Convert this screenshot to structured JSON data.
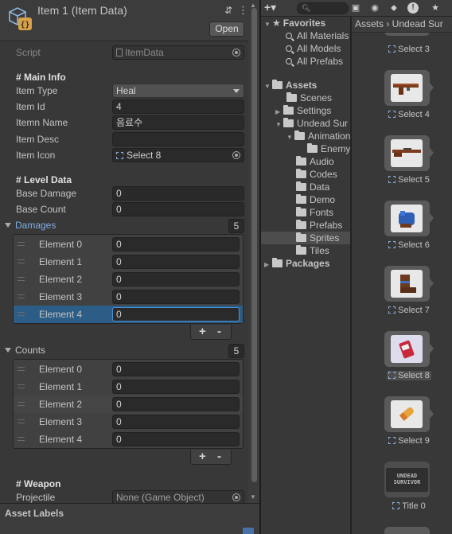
{
  "inspector": {
    "title": "Item 1 (Item Data)",
    "open_label": "Open",
    "script": {
      "label": "Script",
      "value": "ItemData"
    },
    "main_info": {
      "header": "# Main Info",
      "item_type": {
        "label": "Item Type",
        "value": "Heal"
      },
      "item_id": {
        "label": "Item Id",
        "value": "4"
      },
      "item_name": {
        "label": "Itemn Name",
        "value": "음료수"
      },
      "item_desc": {
        "label": "Item Desc",
        "value": ""
      },
      "item_icon": {
        "label": "Item Icon",
        "value": "Select 8"
      }
    },
    "level_data": {
      "header": "# Level Data",
      "base_damage": {
        "label": "Base Damage",
        "value": "0"
      },
      "base_count": {
        "label": "Base Count",
        "value": "0"
      }
    },
    "damages": {
      "label": "Damages",
      "count": "5",
      "elements": [
        {
          "label": "Element 0",
          "value": "0"
        },
        {
          "label": "Element 1",
          "value": "0"
        },
        {
          "label": "Element 2",
          "value": "0"
        },
        {
          "label": "Element 3",
          "value": "0"
        },
        {
          "label": "Element 4",
          "value": "0"
        }
      ],
      "selected_index": 4
    },
    "counts": {
      "label": "Counts",
      "count": "5",
      "elements": [
        {
          "label": "Element 0",
          "value": "0"
        },
        {
          "label": "Element 1",
          "value": "0"
        },
        {
          "label": "Element 2",
          "value": "0"
        },
        {
          "label": "Element 3",
          "value": "0"
        },
        {
          "label": "Element 4",
          "value": "0"
        }
      ]
    },
    "weapon": {
      "header": "# Weapon",
      "projectile": {
        "label": "Projectile",
        "value": "None (Game Object)"
      }
    },
    "plus": "+",
    "minus": "-",
    "asset_labels": "Asset Labels"
  },
  "project": {
    "toolbar": {
      "add": "+▾",
      "search_icon": "search-icon"
    },
    "breadcrumb": "Assets › Undead Sur",
    "tree": {
      "favorites": "Favorites",
      "fav_items": [
        "All Materials",
        "All Models",
        "All Prefabs"
      ],
      "assets": "Assets",
      "scenes": "Scenes",
      "settings": "Settings",
      "undead": "Undead Sur",
      "animation": "Animation",
      "enemy": "Enemy",
      "folders": [
        "Audio",
        "Codes",
        "Data",
        "Demo",
        "Fonts",
        "Prefabs",
        "Sprites",
        "Tiles"
      ],
      "packages": "Packages",
      "selected": "Sprites"
    },
    "grid": {
      "items": [
        {
          "label": "Select 3",
          "icon": "sprite-icon"
        },
        {
          "label": "Select 4",
          "icon": "shotgun-sprite"
        },
        {
          "label": "Select 5",
          "icon": "rifle-sprite"
        },
        {
          "label": "Select 6",
          "icon": "glove-sprite"
        },
        {
          "label": "Select 7",
          "icon": "boot-sprite"
        },
        {
          "label": "Select 8",
          "icon": "drink-sprite",
          "selected": true
        },
        {
          "label": "Select 9",
          "icon": "bullet-sprite"
        },
        {
          "label": "Title 0",
          "icon": "title-sprite"
        }
      ],
      "title_art": "UNDEAD SURVIVOR"
    }
  },
  "colors": {
    "selection": "#2c5d87",
    "panel": "#383838",
    "field": "#2a2a2a"
  }
}
